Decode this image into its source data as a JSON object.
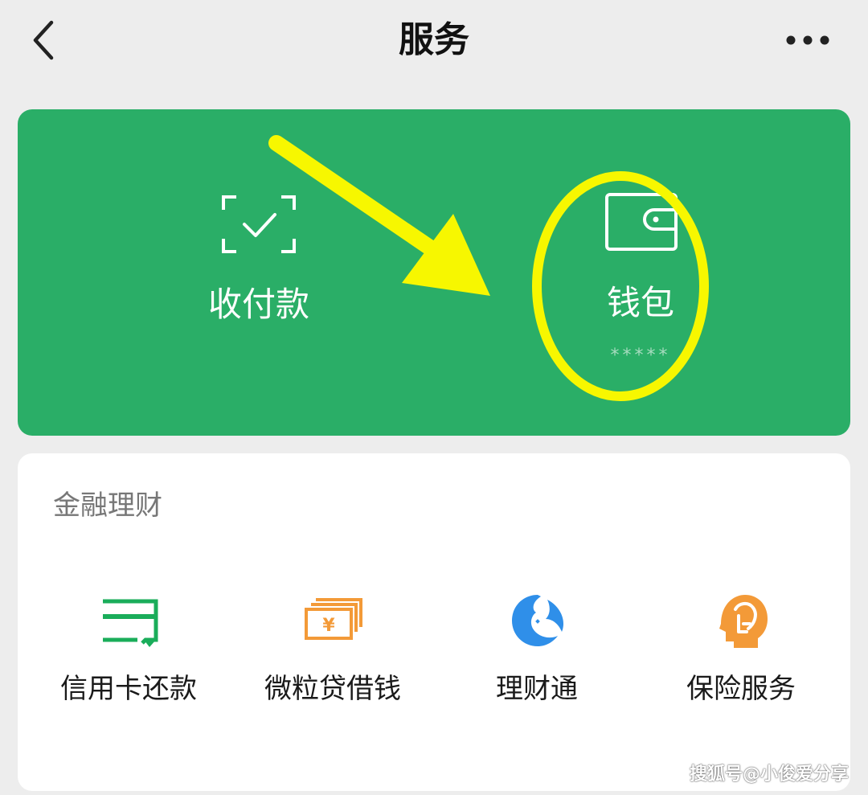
{
  "header": {
    "title": "服务",
    "back_icon": "chevron-left-icon",
    "more_icon": "more-horizontal-icon"
  },
  "wallet_card": {
    "background": "#2aae67",
    "tiles": [
      {
        "label": "收付款",
        "icon": "scan-check-icon"
      },
      {
        "label": "钱包",
        "icon": "wallet-icon",
        "masked_value": "*****"
      }
    ],
    "annotation_color": "#f7f700"
  },
  "finance": {
    "title": "金融理财",
    "items": [
      {
        "label": "信用卡还款",
        "icon": "credit-card-icon",
        "color": "#1aad5a"
      },
      {
        "label": "微粒贷借钱",
        "icon": "banknote-icon",
        "color": "#f39a38"
      },
      {
        "label": "理财通",
        "icon": "licaitong-icon",
        "color": "#2f8fe9"
      },
      {
        "label": "保险服务",
        "icon": "insurance-icon",
        "color": "#f39a38"
      }
    ]
  },
  "watermark": "搜狐号@小俊爱分享"
}
